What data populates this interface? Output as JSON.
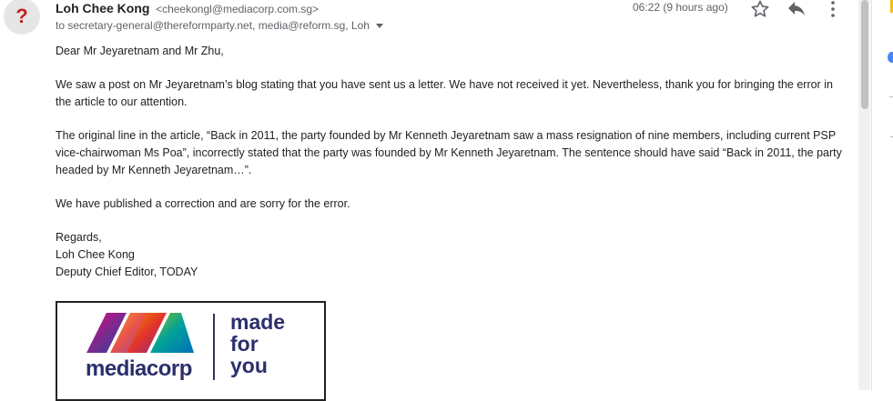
{
  "sender": {
    "avatar_glyph": "?",
    "name": "Loh Chee Kong",
    "email": "<cheekongl@mediacorp.com.sg>",
    "to": "to secretary-general@thereformparty.net, media@reform.sg, Loh",
    "time": "06:22 (9 hours ago)"
  },
  "icons": {
    "star": "star-outline-icon",
    "reply": "reply-icon",
    "more": "more-vert-icon"
  },
  "body": {
    "greeting": "Dear Mr Jeyaretnam and Mr Zhu,",
    "para1": "We saw a post on Mr Jeyaretnam’s blog stating that you have sent us a letter. We have not received it yet. Nevertheless, thank you for bringing the error in the article to our attention.",
    "para2": "The original line in the article, “Back in 2011, the party founded by Mr Kenneth Jeyaretnam saw a mass resignation of nine members, including current PSP vice-chairwoman Ms Poa”, incorrectly stated that the party was founded by Mr Kenneth Jeyaretnam. The sentence should have said “Back in 2011, the party headed by Mr Kenneth Jeyaretnam…”.",
    "para3": "We have published a correction and are sorry for the error.",
    "sign_off": "Regards,",
    "sig_name": "Loh Chee Kong",
    "sig_title": "Deputy Chief Editor, TODAY"
  },
  "logo": {
    "brand": "mediacorp",
    "slogan_1": "made",
    "slogan_2": "for",
    "slogan_3": "you",
    "color": "#2c2f6b"
  },
  "colors": {
    "avatar_bg": "#e6e6e6",
    "avatar_fg": "#c5221f",
    "meta_text": "#5f6368"
  }
}
